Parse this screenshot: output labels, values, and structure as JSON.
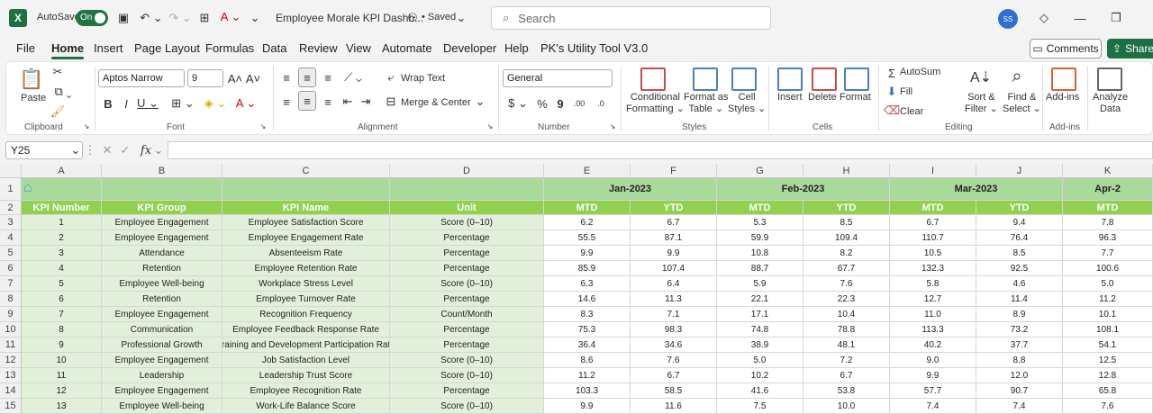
{
  "titlebar": {
    "autosave_label": "AutoSave",
    "autosave_state": "On",
    "doc_title": "Employee Morale KPI Dashb...",
    "saved_label": "• Saved",
    "search_placeholder": "Search",
    "user_initials": "SS"
  },
  "menu": [
    "File",
    "Home",
    "Insert",
    "Page Layout",
    "Formulas",
    "Data",
    "Review",
    "View",
    "Automate",
    "Developer",
    "Help",
    "PK's Utility Tool V3.0"
  ],
  "buttons": {
    "comments": "Comments",
    "share": "Share"
  },
  "ribbon": {
    "paste": "Paste",
    "font_name": "Aptos Narrow",
    "font_size": "9",
    "wrap_text": "Wrap Text",
    "merge_center": "Merge & Center",
    "number_format": "General",
    "cond_fmt": [
      "Conditional",
      "Formatting"
    ],
    "format_table": [
      "Format as",
      "Table"
    ],
    "cell_styles": [
      "Cell",
      "Styles"
    ],
    "insert": "Insert",
    "delete": "Delete",
    "format": "Format",
    "autosum": "AutoSum",
    "fill": "Fill",
    "clear": "Clear",
    "sort_filter": [
      "Sort &",
      "Filter"
    ],
    "find_select": [
      "Find &",
      "Select"
    ],
    "addins": "Add-ins",
    "analyze": [
      "Analyze",
      "Data"
    ],
    "groups": [
      "Clipboard",
      "Font",
      "Alignment",
      "Number",
      "Styles",
      "Cells",
      "Editing",
      "Add-ins"
    ]
  },
  "formula": {
    "name_box": "Y25",
    "fx": "fx"
  },
  "columns": [
    "A",
    "B",
    "C",
    "D",
    "E",
    "F",
    "G",
    "H",
    "I",
    "J",
    "K"
  ],
  "months": [
    "Jan-2023",
    "Feb-2023",
    "Mar-2023",
    "Apr-2"
  ],
  "headers": [
    "KPI Number",
    "KPI Group",
    "KPI Name",
    "Unit",
    "MTD",
    "YTD",
    "MTD",
    "YTD",
    "MTD",
    "YTD",
    "MTD"
  ],
  "row_numbers": [
    "1",
    "2",
    "3",
    "4",
    "5",
    "6",
    "7",
    "8",
    "9",
    "10",
    "11",
    "12",
    "13",
    "14",
    "15"
  ],
  "rows": [
    [
      "1",
      "Employee Engagement",
      "Employee Satisfaction Score",
      "Score (0–10)",
      "6.2",
      "6.7",
      "5.3",
      "8.5",
      "6.7",
      "9.4",
      "7.8"
    ],
    [
      "2",
      "Employee Engagement",
      "Employee Engagement Rate",
      "Percentage",
      "55.5",
      "87.1",
      "59.9",
      "109.4",
      "110.7",
      "76.4",
      "96.3"
    ],
    [
      "3",
      "Attendance",
      "Absenteeism Rate",
      "Percentage",
      "9.9",
      "9.9",
      "10.8",
      "8.2",
      "10.5",
      "8.5",
      "7.7"
    ],
    [
      "4",
      "Retention",
      "Employee Retention Rate",
      "Percentage",
      "85.9",
      "107.4",
      "88.7",
      "67.7",
      "132.3",
      "92.5",
      "100.6"
    ],
    [
      "5",
      "Employee Well-being",
      "Workplace Stress Level",
      "Score (0–10)",
      "6.3",
      "6.4",
      "5.9",
      "7.6",
      "5.8",
      "4.6",
      "5.0"
    ],
    [
      "6",
      "Retention",
      "Employee Turnover Rate",
      "Percentage",
      "14.6",
      "11.3",
      "22.1",
      "22.3",
      "12.7",
      "11.4",
      "11.2"
    ],
    [
      "7",
      "Employee Engagement",
      "Recognition Frequency",
      "Count/Month",
      "8.3",
      "7.1",
      "17.1",
      "10.4",
      "11.0",
      "8.9",
      "10.1"
    ],
    [
      "8",
      "Communication",
      "Employee Feedback Response Rate",
      "Percentage",
      "75.3",
      "98.3",
      "74.8",
      "78.8",
      "113.3",
      "73.2",
      "108.1"
    ],
    [
      "9",
      "Professional Growth",
      "Training and Development Participation Rate",
      "Percentage",
      "36.4",
      "34.6",
      "38.9",
      "48.1",
      "40.2",
      "37.7",
      "54.1"
    ],
    [
      "10",
      "Employee Engagement",
      "Job Satisfaction Level",
      "Score (0–10)",
      "8.6",
      "7.6",
      "5.0",
      "7.2",
      "9.0",
      "8.8",
      "12.5"
    ],
    [
      "11",
      "Leadership",
      "Leadership Trust Score",
      "Score (0–10)",
      "11.2",
      "6.7",
      "10.2",
      "6.7",
      "9.9",
      "12.0",
      "12.8"
    ],
    [
      "12",
      "Employee Engagement",
      "Employee Recognition Rate",
      "Percentage",
      "103.3",
      "58.5",
      "41.6",
      "53.8",
      "57.7",
      "90.7",
      "65.8"
    ],
    [
      "13",
      "Employee Well-being",
      "Work-Life Balance Score",
      "Score (0–10)",
      "9.9",
      "11.6",
      "7.5",
      "10.0",
      "7.4",
      "7.4",
      "7.6"
    ]
  ]
}
